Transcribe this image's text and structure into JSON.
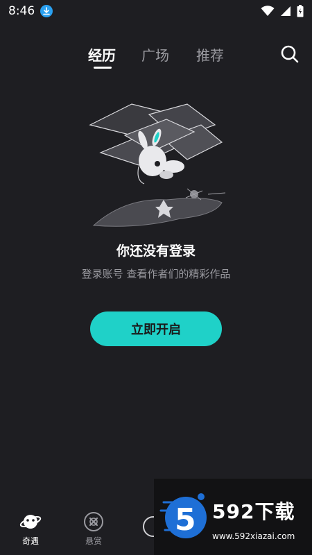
{
  "status_bar": {
    "time": "8:46",
    "icons": [
      "download-badge-icon",
      "wifi-icon",
      "signal-icon",
      "battery-icon"
    ]
  },
  "top_nav": {
    "tabs": [
      {
        "label": "经历",
        "active": true
      },
      {
        "label": "广场",
        "active": false
      },
      {
        "label": "推荐",
        "active": false
      }
    ],
    "search_icon": "search-icon"
  },
  "empty_state": {
    "title": "你还没有登录",
    "subtitle": "登录账号 查看作者们的精彩作品",
    "button_label": "立即开启"
  },
  "bottom_nav": {
    "items": [
      {
        "label": "奇遇",
        "icon": "planet-icon",
        "active": true
      },
      {
        "label": "悬赏",
        "icon": "bounty-icon",
        "active": false
      }
    ],
    "center_icon": "create-icon"
  },
  "watermark": {
    "logo_digit": "5",
    "text": "592下载",
    "url": "www.592xiazai.com"
  },
  "colors": {
    "background": "#1e1e22",
    "accent": "#1fd1c8",
    "muted_text": "#9a9aa0"
  }
}
